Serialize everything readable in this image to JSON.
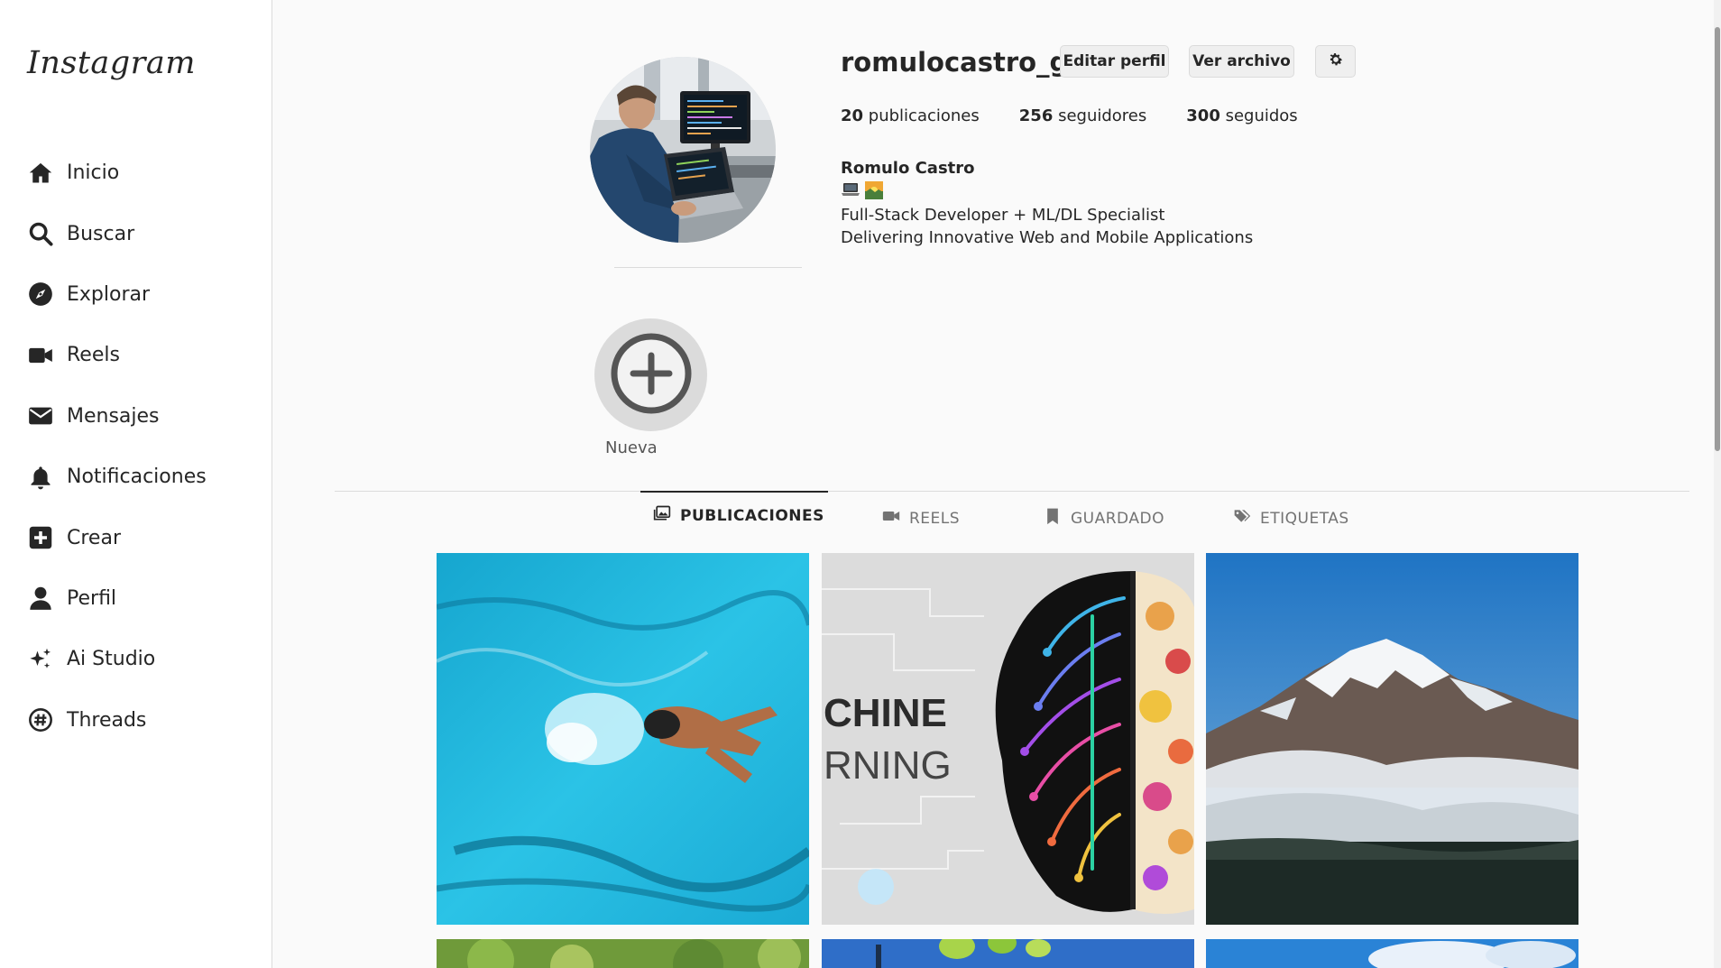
{
  "sidebar": {
    "logo": "Instagram",
    "items": [
      {
        "label": "Inicio",
        "icon": "home-icon"
      },
      {
        "label": "Buscar",
        "icon": "search-icon"
      },
      {
        "label": "Explorar",
        "icon": "compass-icon"
      },
      {
        "label": "Reels",
        "icon": "video-icon"
      },
      {
        "label": "Mensajes",
        "icon": "envelope-icon"
      },
      {
        "label": "Notificaciones",
        "icon": "bell-icon"
      },
      {
        "label": "Crear",
        "icon": "plus-square-icon"
      },
      {
        "label": "Perfil",
        "icon": "user-icon"
      },
      {
        "label": "Ai Studio",
        "icon": "sparkles-icon"
      },
      {
        "label": "Threads",
        "icon": "threads-icon"
      }
    ]
  },
  "profile": {
    "username": "romulocastro_g",
    "edit_label": "Editar perfil",
    "archive_label": "Ver archivo",
    "stats": {
      "posts_count": "20",
      "posts_label": "publicaciones",
      "followers_count": "256",
      "followers_label": "seguidores",
      "following_count": "300",
      "following_label": "seguidos"
    },
    "full_name": "Romulo Castro",
    "bio_line1": "Full-Stack Developer + ML/DL Specialist",
    "bio_line2": "Delivering Innovative Web and Mobile Applications"
  },
  "highlights": {
    "new_label": "Nueva"
  },
  "tabs": [
    {
      "label": "PUBLICACIONES",
      "icon": "grid-icon",
      "active": true
    },
    {
      "label": "REELS",
      "icon": "video-icon",
      "active": false
    },
    {
      "label": "GUARDADO",
      "icon": "bookmark-icon",
      "active": false
    },
    {
      "label": "ETIQUETAS",
      "icon": "tags-icon",
      "active": false
    }
  ],
  "posts": [
    {
      "subject": "swimmer"
    },
    {
      "subject": "machine-learning-brain",
      "text1": "CHINE",
      "text2": "RNING"
    },
    {
      "subject": "snowy-mountain"
    }
  ],
  "colors": {
    "text": "#262626",
    "muted": "#737373",
    "border": "#dbdbdb",
    "background": "#fafafa"
  }
}
